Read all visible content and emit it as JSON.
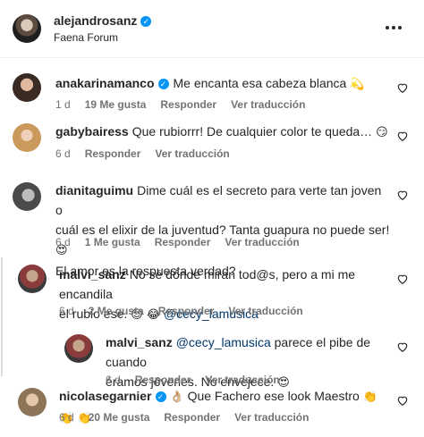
{
  "header": {
    "username": "alejandrosanz",
    "location": "Faena Forum"
  },
  "comments": [
    {
      "username": "anakarinamanco",
      "verified": true,
      "text": "Me encanta esa cabeza blanca",
      "emoji": "💫",
      "time": "1 d",
      "likes": "19 Me gusta",
      "reply": "Responder",
      "translate": "Ver traducción"
    },
    {
      "username": "gabybairess",
      "text": "Que rubiorrr! De cualquier color te queda…",
      "emoji": "😏",
      "time": "6 d",
      "reply": "Responder",
      "translate": "Ver traducción"
    },
    {
      "username": "dianitaguimu",
      "line1": "Dime cuál es el secreto para verte tan joven o",
      "line2": "cuál es el elixir de la juventud? Tanta guapura no puede ser!",
      "line2_emoji": "😍",
      "line3": "El amor es la respuesta verdad?",
      "time": "6 d",
      "likes": "1 Me gusta",
      "reply": "Responder",
      "translate": "Ver traducción"
    },
    {
      "username": "malvi_sanz",
      "line1": "No sé dónde miran tod@s, pero a mi me encandila",
      "line2": "el rubio ese.",
      "line2_emoji": "😍 😂",
      "mention": "@cecy_lamusica",
      "time": "6 d",
      "likes": "2 Me gusta",
      "reply": "Responder",
      "translate": "Ver traducción"
    },
    {
      "username": "malvi_sanz",
      "mention": "@cecy_lamusica",
      "line1": "parece el pibe de cuando",
      "line2": "éramos jóvenes. No envejece.",
      "line2_emoji": "😍",
      "time": "6 d",
      "reply": "Responder",
      "translate": "Ver traducción"
    },
    {
      "username": "nicolasegarnier",
      "verified": true,
      "lead_emoji": "👌🏼",
      "text": "Que Fachero ese look Maestro",
      "emoji": "👏 👏 👏",
      "time": "6 d",
      "likes": "20 Me gusta",
      "reply": "Responder",
      "translate": "Ver traducción"
    }
  ],
  "colors": {
    "text": "#262626",
    "secondary": "#737373",
    "mention": "#00376b",
    "verified": "#0095f6"
  }
}
